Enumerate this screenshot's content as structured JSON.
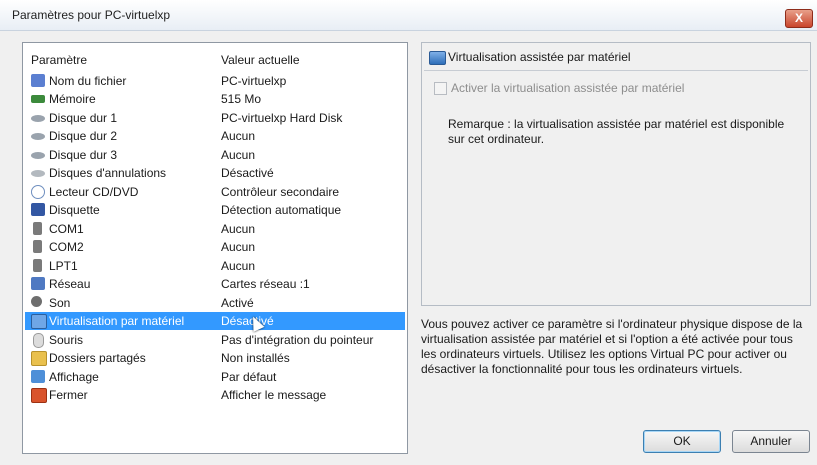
{
  "window": {
    "title": "Paramètres pour PC-virtuelxp",
    "close_label": "X"
  },
  "table": {
    "header_param": "Paramètre",
    "header_value": "Valeur actuelle",
    "rows": [
      {
        "name": "Nom du fichier",
        "value": "PC-virtuelxp",
        "icon": "file-info-icon",
        "color": "#5b7fd1"
      },
      {
        "name": "Mémoire",
        "value": "515 Mo",
        "icon": "memory-icon",
        "color": "#3c8a3c"
      },
      {
        "name": "Disque dur 1",
        "value": "PC-virtuelxp Hard Disk",
        "icon": "hard-disk-icon",
        "color": "#9aa3ad"
      },
      {
        "name": "Disque dur 2",
        "value": "Aucun",
        "icon": "hard-disk-icon",
        "color": "#9aa3ad"
      },
      {
        "name": "Disque dur 3",
        "value": "Aucun",
        "icon": "hard-disk-icon",
        "color": "#9aa3ad"
      },
      {
        "name": "Disques d'annulations",
        "value": "Désactivé",
        "icon": "undo-disk-icon",
        "color": "#b3b9bf"
      },
      {
        "name": "Lecteur CD/DVD",
        "value": "Contrôleur secondaire",
        "icon": "cd-dvd-icon",
        "color": "#8aa5c9"
      },
      {
        "name": "Disquette",
        "value": "Détection automatique",
        "icon": "floppy-icon",
        "color": "#3357a3"
      },
      {
        "name": "COM1",
        "value": "Aucun",
        "icon": "com-port-icon",
        "color": "#7a7a7a"
      },
      {
        "name": "COM2",
        "value": "Aucun",
        "icon": "com-port-icon",
        "color": "#7a7a7a"
      },
      {
        "name": "LPT1",
        "value": "Aucun",
        "icon": "lpt-port-icon",
        "color": "#7a7a7a"
      },
      {
        "name": "Réseau",
        "value": "Cartes réseau :1",
        "icon": "network-icon",
        "color": "#4f79c2"
      },
      {
        "name": "Son",
        "value": "Activé",
        "icon": "sound-icon",
        "color": "#6e6e6e"
      },
      {
        "name": "Virtualisation par matériel",
        "value": "Désactivé",
        "icon": "hardware-virtualization-icon",
        "color": "#6fa6e6",
        "selected": true
      },
      {
        "name": "Souris",
        "value": "Pas d'intégration du pointeur",
        "icon": "mouse-icon",
        "color": "#dcdcdc"
      },
      {
        "name": "Dossiers partagés",
        "value": "Non installés",
        "icon": "shared-folder-icon",
        "color": "#e9c04d"
      },
      {
        "name": "Affichage",
        "value": "Par défaut",
        "icon": "display-icon",
        "color": "#4e8fd8"
      },
      {
        "name": "Fermer",
        "value": "Afficher le message",
        "icon": "close-setting-icon",
        "color": "#d9532c"
      }
    ]
  },
  "detail": {
    "title": "Virtualisation assistée par matériel",
    "checkbox_label": "Activer la virtualisation assistée par matériel",
    "checkbox_checked": false,
    "remark": "Remarque : la virtualisation assistée par matériel est disponible sur cet ordinateur.",
    "description": "Vous pouvez activer ce paramètre si l'ordinateur physique dispose de la virtualisation assistée par matériel et si l'option a été activée pour tous les ordinateurs virtuels. Utilisez les options Virtual PC pour activer ou désactiver la fonctionnalité pour tous les ordinateurs virtuels."
  },
  "buttons": {
    "ok": "OK",
    "cancel": "Annuler"
  }
}
